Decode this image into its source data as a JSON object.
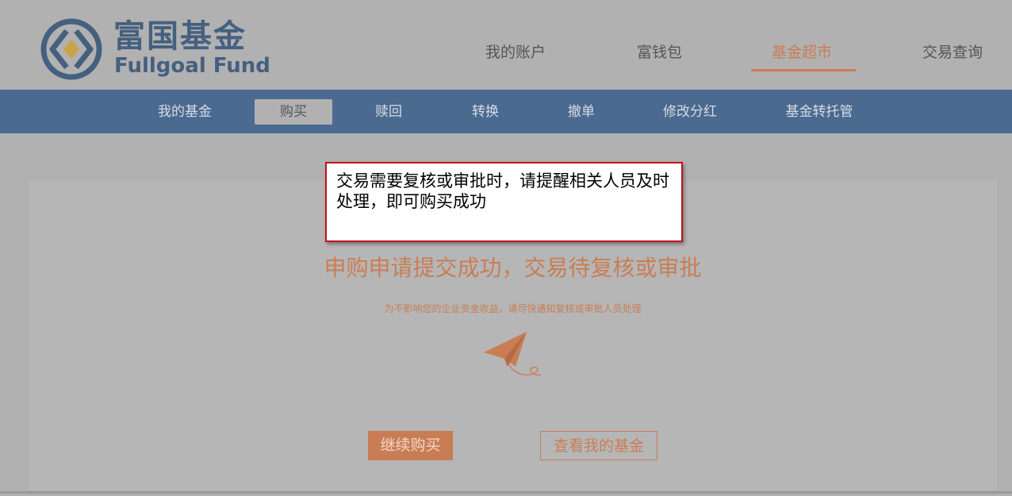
{
  "logo": {
    "name_cn": "富国基金",
    "name_en": "Fullgoal Fund"
  },
  "top_nav": {
    "items": [
      {
        "label": "我的账户"
      },
      {
        "label": "富钱包"
      },
      {
        "label": "基金超市",
        "active": true
      },
      {
        "label": "交易查询"
      }
    ]
  },
  "sub_nav": {
    "items": [
      {
        "label": "我的基金"
      },
      {
        "label": "购买",
        "active": true
      },
      {
        "label": "赎回"
      },
      {
        "label": "转换"
      },
      {
        "label": "撤单"
      },
      {
        "label": "修改分红"
      },
      {
        "label": "基金转托管"
      }
    ]
  },
  "result": {
    "title": "申购申请提交成功，交易待复核或审批",
    "subtitle": "为不影响您的企业资金收益，请尽快通知复核或审批人员处理",
    "icon": "paper-plane-icon",
    "continue_label": "继续购买",
    "view_label": "查看我的基金"
  },
  "callout": {
    "text": "交易需要复核或审批时，请提醒相关人员及时处理，即可购买成功"
  },
  "colors": {
    "brand_blue": "#45607f",
    "nav_blue": "#4a6a90",
    "accent_orange": "#c97d55",
    "callout_border": "#c0121a"
  }
}
